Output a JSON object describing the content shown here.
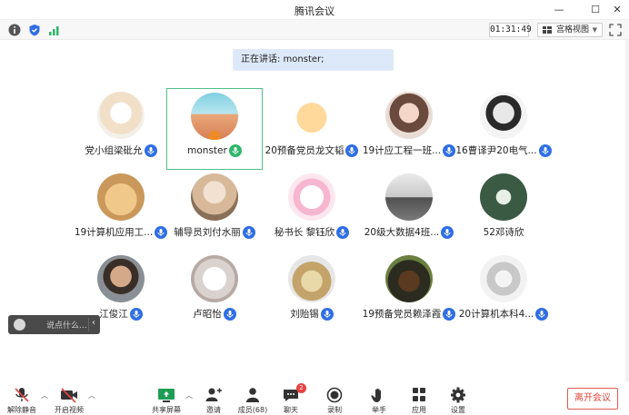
{
  "window": {
    "title": "腾讯会议"
  },
  "topbar": {
    "timer": "01:31:49",
    "view_label": "宫格视图"
  },
  "speaker_banner": {
    "text": "正在讲话: monster;"
  },
  "participants": [
    {
      "name": "党小组梁砒允",
      "mic": "blue"
    },
    {
      "name": "monster",
      "mic": "green",
      "active": true
    },
    {
      "name": "20预备党员龙文韬",
      "mic": "blue"
    },
    {
      "name": "19计应工程一班...",
      "mic": "blue"
    },
    {
      "name": "16曹译尹20电气...",
      "mic": "blue"
    },
    {
      "name": "19计算机应用工...",
      "mic": "blue"
    },
    {
      "name": "辅导员刘付水丽",
      "mic": "blue"
    },
    {
      "name": "秘书长 黎钰欣",
      "mic": "blue"
    },
    {
      "name": "20级大数据4班...",
      "mic": "blue"
    },
    {
      "name": "52邓诗欣",
      "mic": "none"
    },
    {
      "name": "江俊江",
      "mic": "blue"
    },
    {
      "name": "卢昭怡",
      "mic": "blue"
    },
    {
      "name": "刘贻锡",
      "mic": "blue"
    },
    {
      "name": "19预备党员赖泽霞",
      "mic": "blue"
    },
    {
      "name": "20计算机本科4...",
      "mic": "blue"
    }
  ],
  "chat_float": {
    "placeholder": "说点什么..."
  },
  "bottombar": {
    "unmute": "解除静音",
    "start_video": "开启视频",
    "share_screen": "共享屏幕",
    "invite": "邀请",
    "members": "成员(68)",
    "chat": "聊天",
    "chat_badge": "2",
    "record": "录制",
    "raise_hand": "举手",
    "apps": "应用",
    "settings": "设置",
    "leave": "离开会议"
  },
  "colors": {
    "accent_blue": "#2f6ee5",
    "active_green": "#4fbf8a",
    "leave_red": "#e0463c"
  }
}
